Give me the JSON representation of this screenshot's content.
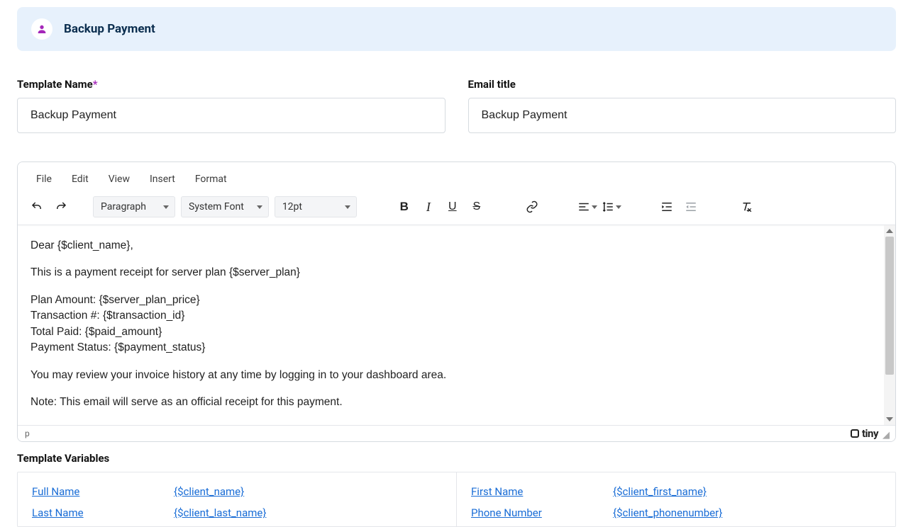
{
  "banner": {
    "title": "Backup Payment"
  },
  "fields": {
    "template_name": {
      "label": "Template Name",
      "value": "Backup Payment"
    },
    "email_title": {
      "label": "Email title",
      "value": "Backup Payment"
    }
  },
  "menu": {
    "file": "File",
    "edit": "Edit",
    "view": "View",
    "insert": "Insert",
    "format": "Format"
  },
  "toolbar": {
    "block": "Paragraph",
    "font": "System Font",
    "size": "12pt"
  },
  "editor": {
    "p1": "Dear {$client_name},",
    "p2": "This is a payment receipt for server plan {$server_plan}",
    "l1": "Plan Amount: {$server_plan_price}",
    "l2": "Transaction #: {$transaction_id}",
    "l3": "Total Paid: {$paid_amount}",
    "l4": "Payment Status: {$payment_status}",
    "p3": "You may review your invoice history at any time by logging in to your dashboard area.",
    "p4": "Note: This email will serve as an official receipt for this payment."
  },
  "statusbar": {
    "path": "p",
    "brand": "tiny"
  },
  "vars_heading": "Template Variables",
  "vars": {
    "left": [
      {
        "label": "Full Name",
        "token": "{$client_name}"
      },
      {
        "label": "Last Name",
        "token": "{$client_last_name}"
      }
    ],
    "right": [
      {
        "label": "First Name",
        "token": "{$client_first_name}"
      },
      {
        "label": "Phone Number",
        "token": "{$client_phonenumber}"
      }
    ]
  }
}
